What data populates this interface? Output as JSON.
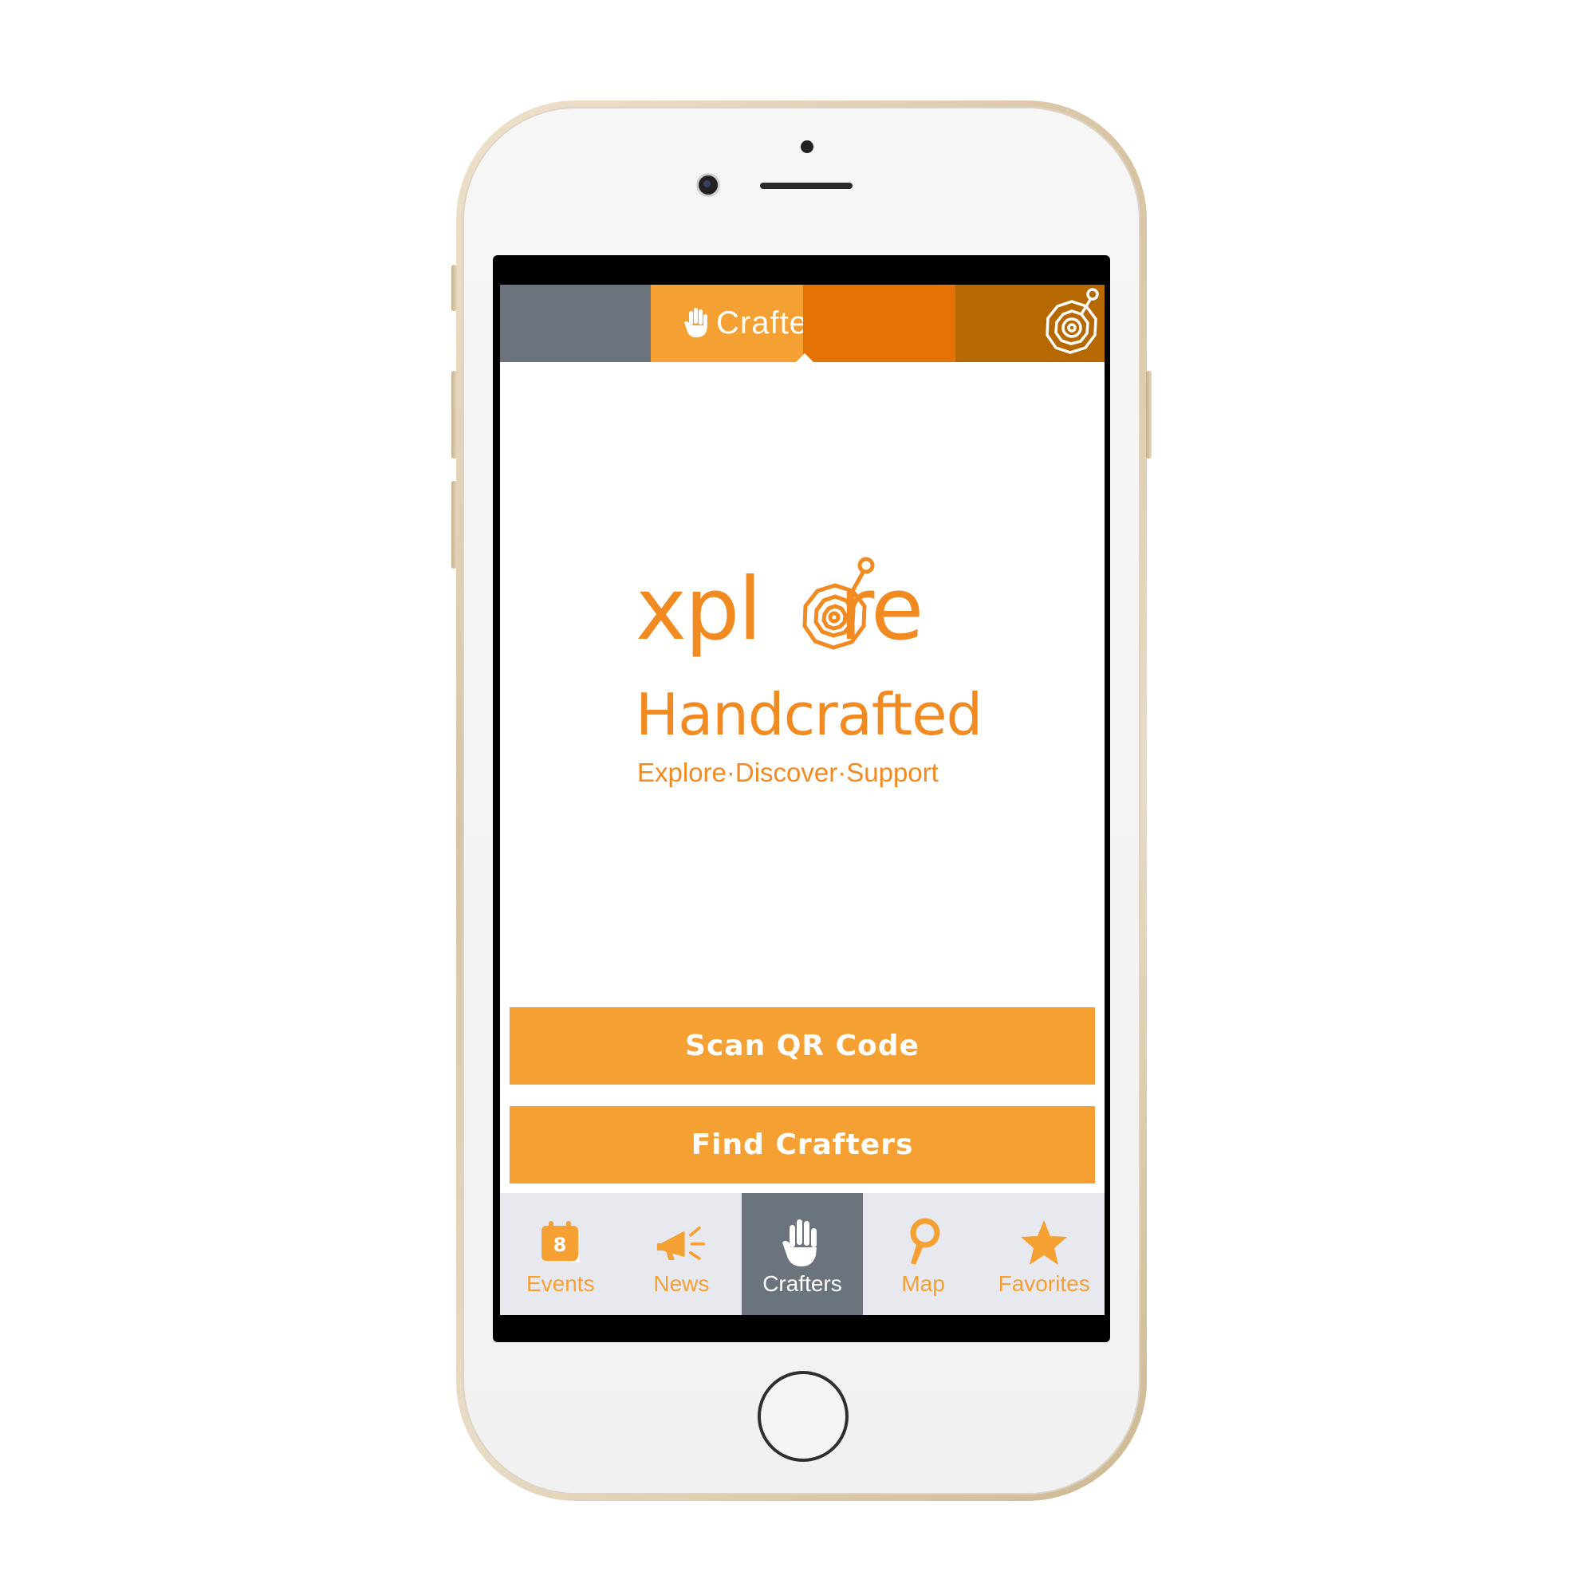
{
  "header": {
    "title": "Crafters",
    "title_icon": "hand-icon",
    "corner_icon": "target-pin-icon"
  },
  "logo": {
    "line1_part1": "xpl",
    "line1_part2": "re",
    "line2": "Handcrafted",
    "tagline": "Explore·Discover·Support"
  },
  "buttons": {
    "scan": "Scan QR Code",
    "find": "Find Crafters"
  },
  "tabs": [
    {
      "label": "Events",
      "icon": "calendar-icon",
      "badge": "8",
      "active": false
    },
    {
      "label": "News",
      "icon": "megaphone-icon",
      "active": false
    },
    {
      "label": "Crafters",
      "icon": "hand-icon",
      "active": true
    },
    {
      "label": "Map",
      "icon": "map-pin-icon",
      "active": false
    },
    {
      "label": "Favorites",
      "icon": "star-icon",
      "active": false
    }
  ],
  "colors": {
    "accent": "#f5a032",
    "orange": "#e57205",
    "dark_orange": "#b56900",
    "grey": "#6b747d",
    "logo": "#f18a21",
    "tabbar_bg": "#e8e8ef"
  }
}
